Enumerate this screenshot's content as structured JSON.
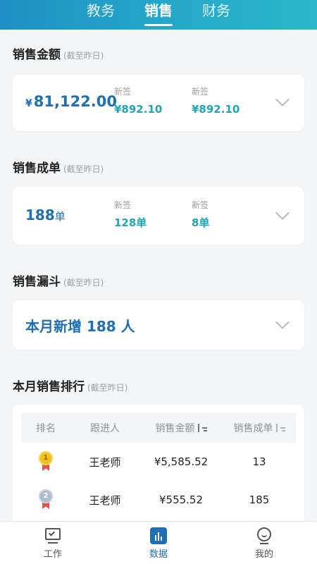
{
  "tabs": [
    {
      "label": "教务",
      "active": false
    },
    {
      "label": "销售",
      "active": true
    },
    {
      "label": "财务",
      "active": false
    }
  ],
  "as_of_note": "(截至昨日)",
  "sales_amount": {
    "title": "销售金额",
    "currency": "¥",
    "total": "81,122.00",
    "stats": [
      {
        "label": "新签",
        "value": "¥892.10"
      },
      {
        "label": "新签",
        "value": "¥892.10"
      }
    ]
  },
  "sales_orders": {
    "title": "销售成单",
    "total": "188",
    "unit": "单",
    "stats": [
      {
        "label": "新签",
        "value": "128单"
      },
      {
        "label": "新签",
        "value": "8单"
      }
    ]
  },
  "sales_funnel": {
    "title": "销售漏斗",
    "text": "本月新增 188 人"
  },
  "ranking": {
    "title": "本月销售排行",
    "headers": [
      "排名",
      "跟进人",
      "销售金额",
      "销售成单"
    ],
    "rows": [
      {
        "rank": "1",
        "medal": "gold",
        "name": "王老师",
        "amount": "¥5,585.52",
        "orders": "13"
      },
      {
        "rank": "2",
        "medal": "silver",
        "name": "王老师",
        "amount": "¥555.52",
        "orders": "185"
      }
    ]
  },
  "bottom_nav": [
    {
      "label": "工作",
      "icon": "work-icon",
      "active": false
    },
    {
      "label": "数据",
      "icon": "data-icon",
      "active": true
    },
    {
      "label": "我的",
      "icon": "profile-icon",
      "active": false
    }
  ],
  "colors": {
    "header_gradient_start": "#1f8fc4",
    "header_gradient_end": "#2ab7c9",
    "primary_blue": "#1f6fb6",
    "teal_value": "#1aa7b8"
  }
}
